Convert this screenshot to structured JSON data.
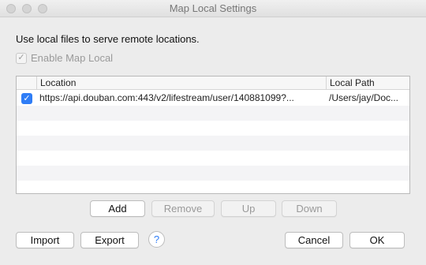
{
  "window": {
    "title": "Map Local Settings"
  },
  "intro_text": "Use local files to serve remote locations.",
  "enable": {
    "label": "Enable Map Local",
    "checked": true,
    "mark": "✓"
  },
  "table": {
    "columns": {
      "location": "Location",
      "local_path": "Local Path"
    },
    "rows": [
      {
        "checked": true,
        "mark": "✓",
        "location": "https://api.douban.com:443/v2/lifestream/user/140881099?...",
        "local_path": "/Users/jay/Doc..."
      }
    ]
  },
  "row_buttons": {
    "add": "Add",
    "remove": "Remove",
    "up": "Up",
    "down": "Down"
  },
  "footer_buttons": {
    "import": "Import",
    "export": "Export",
    "help": "?",
    "cancel": "Cancel",
    "ok": "OK"
  },
  "colors": {
    "accent": "#2f7df6"
  }
}
